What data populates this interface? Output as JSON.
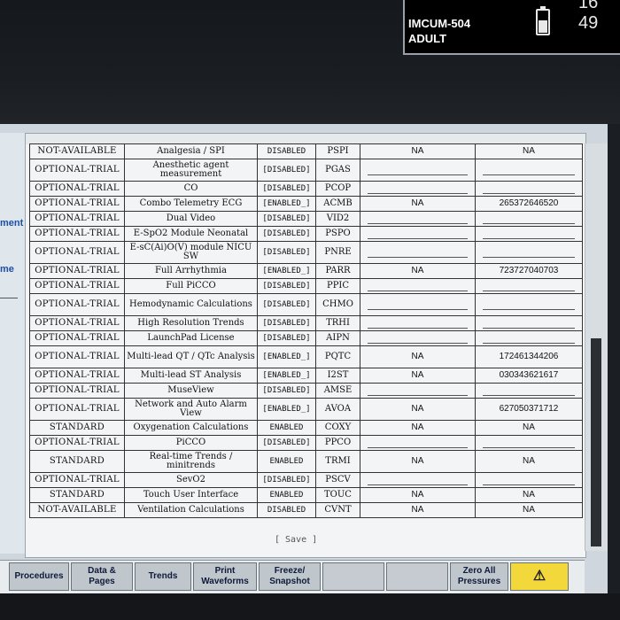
{
  "monitor": {
    "bed_label": "IMCUM-504",
    "patient_type": "ADULT",
    "clock": "16 49"
  },
  "side_labels": [
    "ment",
    "me"
  ],
  "table": {
    "rows": [
      {
        "status": "NOT-AVAILABLE",
        "option": "Analgesia / SPI",
        "state": "DISABLED",
        "code": "PSPI",
        "value": "NA",
        "value2": "NA"
      },
      {
        "status": "OPTIONAL-TRIAL",
        "option": "Anesthetic agent measurement",
        "state": "[DISABLED]",
        "code": "PGAS",
        "value": "",
        "value2": ""
      },
      {
        "status": "OPTIONAL-TRIAL",
        "option": "CO",
        "state": "[DISABLED]",
        "code": "PCOP",
        "value": "",
        "value2": ""
      },
      {
        "status": "OPTIONAL-TRIAL",
        "option": "Combo Telemetry ECG",
        "state": "[ENABLED_]",
        "code": "ACMB",
        "value": "NA",
        "value2": "265372646520"
      },
      {
        "status": "OPTIONAL-TRIAL",
        "option": "Dual Video",
        "state": "[DISABLED]",
        "code": "VID2",
        "value": "",
        "value2": ""
      },
      {
        "status": "OPTIONAL-TRIAL",
        "option": "E-SpO2 Module Neonatal",
        "state": "[DISABLED]",
        "code": "PSPO",
        "value": "",
        "value2": ""
      },
      {
        "status": "OPTIONAL-TRIAL",
        "option": "E-sC(Ai)O(V) module NICU SW",
        "state": "[DISABLED]",
        "code": "PNRE",
        "value": "",
        "value2": ""
      },
      {
        "status": "OPTIONAL-TRIAL",
        "option": "Full Arrhythmia",
        "state": "[ENABLED_]",
        "code": "PARR",
        "value": "NA",
        "value2": "723727040703"
      },
      {
        "status": "OPTIONAL-TRIAL",
        "option": "Full PiCCO",
        "state": "[DISABLED]",
        "code": "PPIC",
        "value": "",
        "value2": ""
      },
      {
        "status": "OPTIONAL-TRIAL",
        "option": "Hemodynamic Calculations",
        "state": "[DISABLED]",
        "code": "CHMO",
        "value": "",
        "value2": ""
      },
      {
        "status": "OPTIONAL-TRIAL",
        "option": "High Resolution Trends",
        "state": "[DISABLED]",
        "code": "TRHI",
        "value": "",
        "value2": ""
      },
      {
        "status": "OPTIONAL-TRIAL",
        "option": "LaunchPad License",
        "state": "[DISABLED]",
        "code": "AIPN",
        "value": "",
        "value2": ""
      },
      {
        "status": "OPTIONAL-TRIAL",
        "option": "Multi-lead QT / QTc Analysis",
        "state": "[ENABLED_]",
        "code": "PQTC",
        "value": "NA",
        "value2": "172461344206"
      },
      {
        "status": "OPTIONAL-TRIAL",
        "option": "Multi-lead ST Analysis",
        "state": "[ENABLED_]",
        "code": "I2ST",
        "value": "NA",
        "value2": "030343621617"
      },
      {
        "status": "OPTIONAL-TRIAL",
        "option": "MuseView",
        "state": "[DISABLED]",
        "code": "AMSE",
        "value": "",
        "value2": ""
      },
      {
        "status": "OPTIONAL-TRIAL",
        "option": "Network and Auto Alarm View",
        "state": "[ENABLED_]",
        "code": "AVOA",
        "value": "NA",
        "value2": "627050371712"
      },
      {
        "status": "STANDARD",
        "option": "Oxygenation Calculations",
        "state": "ENABLED",
        "code": "COXY",
        "value": "NA",
        "value2": "NA"
      },
      {
        "status": "OPTIONAL-TRIAL",
        "option": "PiCCO",
        "state": "[DISABLED]",
        "code": "PPCO",
        "value": "",
        "value2": ""
      },
      {
        "status": "STANDARD",
        "option": "Real-time Trends / minitrends",
        "state": "ENABLED",
        "code": "TRMI",
        "value": "NA",
        "value2": "NA"
      },
      {
        "status": "OPTIONAL-TRIAL",
        "option": "SevO2",
        "state": "[DISABLED]",
        "code": "PSCV",
        "value": "",
        "value2": ""
      },
      {
        "status": "STANDARD",
        "option": "Touch User Interface",
        "state": "ENABLED",
        "code": "TOUC",
        "value": "NA",
        "value2": "NA"
      },
      {
        "status": "NOT-AVAILABLE",
        "option": "Ventilation Calculations",
        "state": "DISABLED",
        "code": "CVNT",
        "value": "NA",
        "value2": "NA"
      }
    ]
  },
  "save_label": "[ Save ]",
  "toolbar": {
    "buttons": [
      {
        "label": "Procedures",
        "enabled": true
      },
      {
        "label": "Data &\nPages",
        "enabled": true
      },
      {
        "label": "Trends",
        "enabled": true
      },
      {
        "label": "Print\nWaveforms",
        "enabled": true
      },
      {
        "label": "Freeze/\nSnapshot",
        "enabled": true
      },
      {
        "label": "",
        "enabled": false
      },
      {
        "label": "",
        "enabled": false
      },
      {
        "label": "Zero All\nPressures",
        "enabled": true
      },
      {
        "label": "",
        "enabled": true,
        "icon": "alarm-silence-icon"
      }
    ]
  },
  "colors": {
    "alarm": "#f2d83a",
    "side_label": "#1c4fa8"
  }
}
